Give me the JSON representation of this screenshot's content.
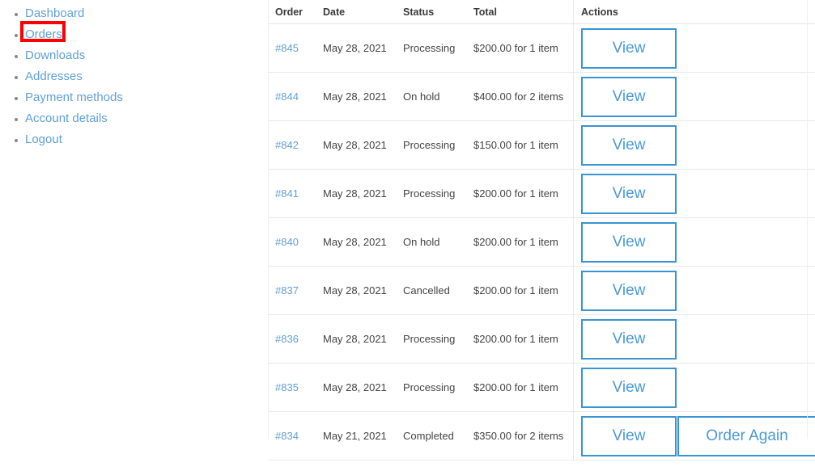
{
  "sidebar": {
    "items": [
      {
        "label": "Dashboard",
        "name": "sidebar-item-dashboard"
      },
      {
        "label": "Orders",
        "name": "sidebar-item-orders",
        "highlighted": true
      },
      {
        "label": "Downloads",
        "name": "sidebar-item-downloads"
      },
      {
        "label": "Addresses",
        "name": "sidebar-item-addresses"
      },
      {
        "label": "Payment methods",
        "name": "sidebar-item-payment-methods"
      },
      {
        "label": "Account details",
        "name": "sidebar-item-account-details"
      },
      {
        "label": "Logout",
        "name": "sidebar-item-logout"
      }
    ]
  },
  "orders_table": {
    "columns": [
      "Order",
      "Date",
      "Status",
      "Total",
      "Actions"
    ],
    "rows": [
      {
        "order": "#845",
        "date": "May 28, 2021",
        "status": "Processing",
        "total": "$200.00 for 1 item",
        "view_label": "View",
        "order_again_label": null
      },
      {
        "order": "#844",
        "date": "May 28, 2021",
        "status": "On hold",
        "total": "$400.00 for 2 items",
        "view_label": "View",
        "order_again_label": null
      },
      {
        "order": "#842",
        "date": "May 28, 2021",
        "status": "Processing",
        "total": "$150.00 for 1 item",
        "view_label": "View",
        "order_again_label": null
      },
      {
        "order": "#841",
        "date": "May 28, 2021",
        "status": "Processing",
        "total": "$200.00 for 1 item",
        "view_label": "View",
        "order_again_label": null
      },
      {
        "order": "#840",
        "date": "May 28, 2021",
        "status": "On hold",
        "total": "$200.00 for 1 item",
        "view_label": "View",
        "order_again_label": null
      },
      {
        "order": "#837",
        "date": "May 28, 2021",
        "status": "Cancelled",
        "total": "$200.00 for 1 item",
        "view_label": "View",
        "order_again_label": null
      },
      {
        "order": "#836",
        "date": "May 28, 2021",
        "status": "Processing",
        "total": "$200.00 for 1 item",
        "view_label": "View",
        "order_again_label": null
      },
      {
        "order": "#835",
        "date": "May 28, 2021",
        "status": "Processing",
        "total": "$200.00 for 1 item",
        "view_label": "View",
        "order_again_label": null
      },
      {
        "order": "#834",
        "date": "May 21, 2021",
        "status": "Completed",
        "total": "$350.00 for 2 items",
        "view_label": "View",
        "order_again_label": "Order Again"
      }
    ]
  },
  "colors": {
    "link_blue": "#60a0d8",
    "button_border_blue": "#3a93d4",
    "button_text_blue": "#4a9ada",
    "annotation_red": "#fe0000",
    "text_dark": "#444444",
    "header_text": "#3a3a3a",
    "row_divider": "#e8e8e8"
  }
}
